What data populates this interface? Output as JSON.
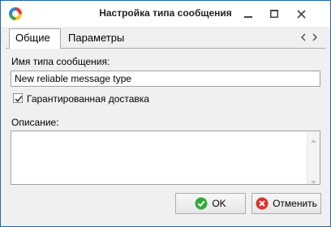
{
  "window": {
    "title": "Настройка типа сообщения",
    "icon": "app-logo-icon",
    "controls": [
      "minimize-icon",
      "maximize-icon",
      "close-icon"
    ]
  },
  "tabs": [
    {
      "label": "Общие",
      "active": true
    },
    {
      "label": "Параметры",
      "active": false
    }
  ],
  "tab_scroll": {
    "left_icon": "triangle-left-icon",
    "right_icon": "triangle-right-icon"
  },
  "form": {
    "name_label": "Имя типа сообщения:",
    "name_value": "New reliable message type",
    "guaranteed_label": "Гарантированная доставка",
    "guaranteed_checked": true,
    "description_label": "Описание:",
    "description_value": ""
  },
  "buttons": {
    "ok_label": "OK",
    "ok_icon": "check-circle-icon",
    "cancel_label": "Отменить",
    "cancel_icon": "cancel-circle-icon"
  },
  "colors": {
    "ok_green": "#2eaa3a",
    "cancel_red": "#d9342b",
    "window_border": "#1e6aa8"
  }
}
